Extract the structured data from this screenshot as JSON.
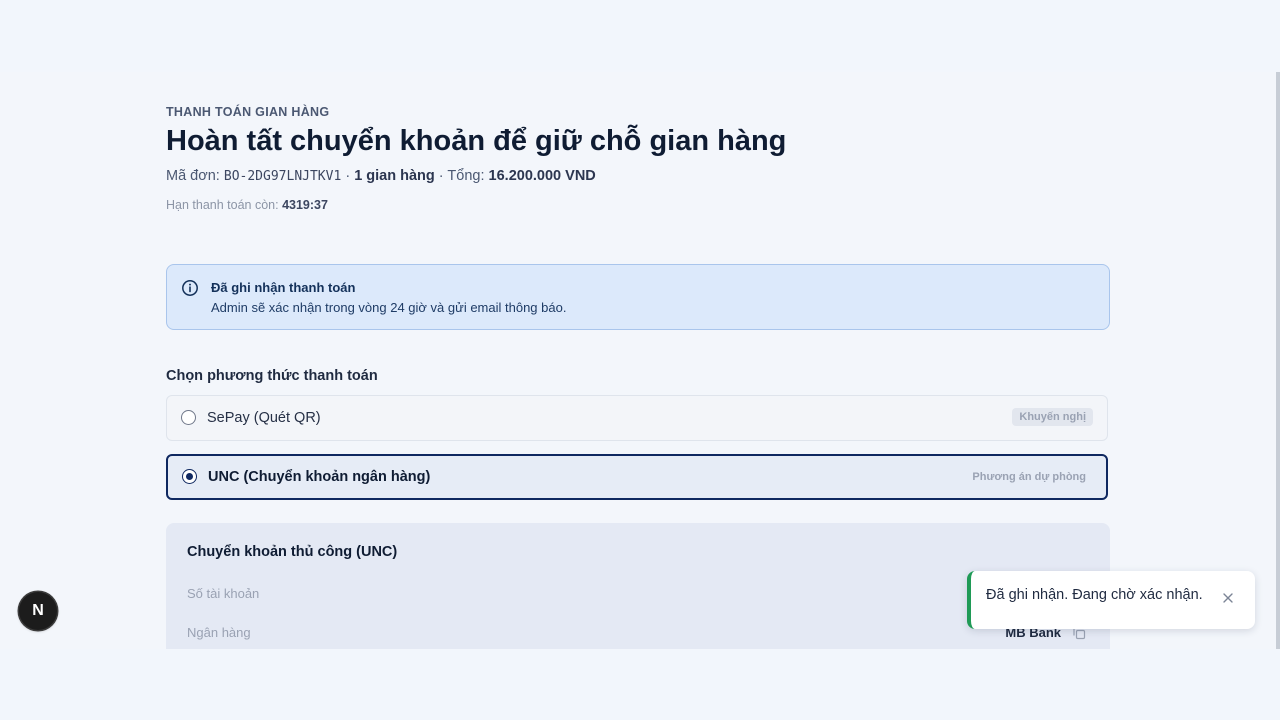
{
  "header": {
    "eyebrow": "THANH TOÁN GIAN HÀNG",
    "title": "Hoàn tất chuyển khoản để giữ chỗ gian hàng",
    "order": {
      "code_label": "Mã đơn:",
      "code": "BO-2DG97LNJTKV1",
      "separator": "·",
      "booth_count": "1 gian hàng",
      "total_label": "Tổng:",
      "total_value": "16.200.000 VND"
    },
    "deadline": {
      "label": "Hạn thanh toán còn:",
      "value": "4319:37"
    }
  },
  "alert": {
    "icon": "info-icon",
    "title": "Đã ghi nhận thanh toán",
    "body": "Admin sẽ xác nhận trong vòng 24 giờ và gửi email thông báo."
  },
  "payment_methods": {
    "label": "Chọn phương thức thanh toán",
    "options": [
      {
        "label": "SePay (Quét QR)",
        "badge": "Khuyến nghị",
        "selected": false
      },
      {
        "label": "UNC (Chuyển khoản ngân hàng)",
        "badge": "Phương án dự phòng",
        "selected": true
      }
    ]
  },
  "manual_transfer": {
    "title": "Chuyển khoản thủ công (UNC)",
    "fields": [
      {
        "label": "Số tài khoản",
        "value": ""
      },
      {
        "label": "Ngân hàng",
        "value": "MB Bank",
        "icon": "copy-icon"
      }
    ]
  },
  "toast": {
    "message": "Đã ghi nhận. Đang chờ xác nhận.",
    "close_icon": "close-icon",
    "accent": "#1f9a56"
  },
  "dev_badge": {
    "letter": "N"
  },
  "colors": {
    "primary": "#0f2860",
    "alert_bg": "#dce9fb",
    "success": "#1f9a56"
  }
}
